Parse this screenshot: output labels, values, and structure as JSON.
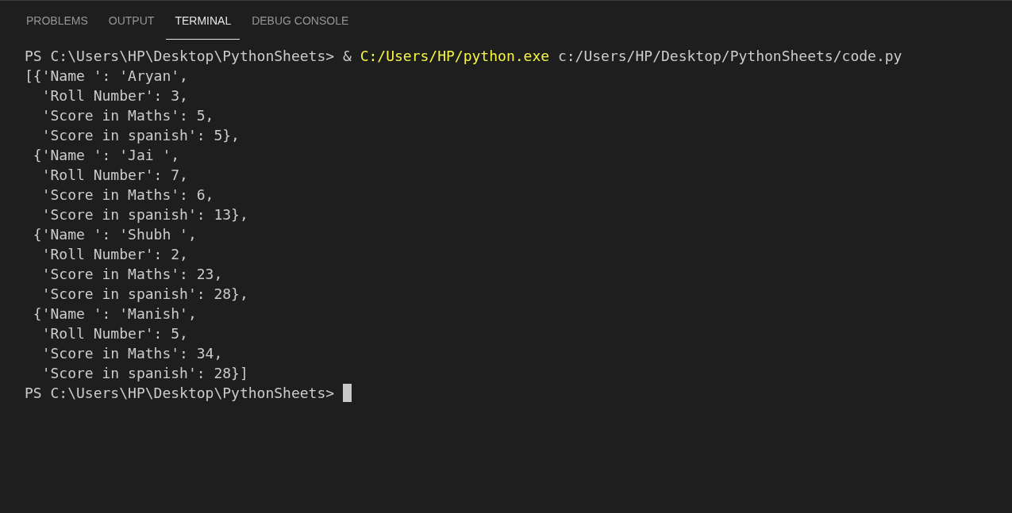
{
  "tabs": [
    {
      "label": "PROBLEMS",
      "selected": false
    },
    {
      "label": "OUTPUT",
      "selected": false
    },
    {
      "label": "TERMINAL",
      "selected": true
    },
    {
      "label": "DEBUG CONSOLE",
      "selected": false
    }
  ],
  "terminal": {
    "lines": [
      {
        "segments": [
          {
            "kind": "prompt",
            "text": "PS C:\\Users\\HP\\Desktop\\PythonSheets> &"
          },
          {
            "kind": "command",
            "text": "C:/Users/HP/python.exe"
          },
          {
            "kind": "argument",
            "text": "c:/Users/HP/Desktop/PythonSheets/code.py"
          }
        ]
      },
      {
        "segments": [
          {
            "kind": "output",
            "text": "[{'Name ': 'Aryan',"
          }
        ]
      },
      {
        "segments": [
          {
            "kind": "output",
            "text": "  'Roll Number': 3,"
          }
        ]
      },
      {
        "segments": [
          {
            "kind": "output",
            "text": "  'Score in Maths': 5,"
          }
        ]
      },
      {
        "segments": [
          {
            "kind": "output",
            "text": "  'Score in spanish': 5},"
          }
        ]
      },
      {
        "segments": [
          {
            "kind": "output",
            "text": " {'Name ': 'Jai ',"
          }
        ]
      },
      {
        "segments": [
          {
            "kind": "output",
            "text": "  'Roll Number': 7,"
          }
        ]
      },
      {
        "segments": [
          {
            "kind": "output",
            "text": "  'Score in Maths': 6,"
          }
        ]
      },
      {
        "segments": [
          {
            "kind": "output",
            "text": "  'Score in spanish': 13},"
          }
        ]
      },
      {
        "segments": [
          {
            "kind": "output",
            "text": " {'Name ': 'Shubh ',"
          }
        ]
      },
      {
        "segments": [
          {
            "kind": "output",
            "text": "  'Roll Number': 2,"
          }
        ]
      },
      {
        "segments": [
          {
            "kind": "output",
            "text": "  'Score in Maths': 23,"
          }
        ]
      },
      {
        "segments": [
          {
            "kind": "output",
            "text": "  'Score in spanish': 28},"
          }
        ]
      },
      {
        "segments": [
          {
            "kind": "output",
            "text": " {'Name ': 'Manish',"
          }
        ]
      },
      {
        "segments": [
          {
            "kind": "output",
            "text": "  'Roll Number': 5,"
          }
        ]
      },
      {
        "segments": [
          {
            "kind": "output",
            "text": "  'Score in Maths': 34,"
          }
        ]
      },
      {
        "segments": [
          {
            "kind": "output",
            "text": "  'Score in spanish': 28}]"
          }
        ]
      },
      {
        "segments": [
          {
            "kind": "prompt",
            "text": "PS C:\\Users\\HP\\Desktop\\PythonSheets>"
          },
          {
            "kind": "cursor"
          }
        ]
      }
    ]
  }
}
